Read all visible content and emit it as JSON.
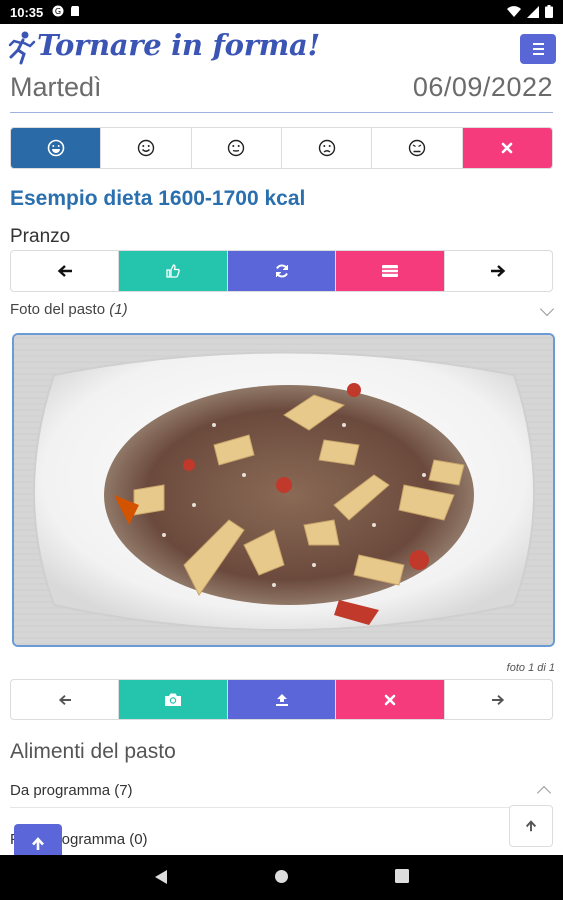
{
  "status": {
    "time": "10:35"
  },
  "app": {
    "title": "Tornare in forma!"
  },
  "header": {
    "day": "Martedì",
    "date": "06/09/2022"
  },
  "diet": {
    "title": "Esempio dieta 1600-1700 kcal",
    "meal": "Pranzo"
  },
  "photo": {
    "label": "Foto del pasto",
    "count": "(1)",
    "caption": "foto 1 di 1"
  },
  "foods": {
    "title": "Alimenti del pasto",
    "sections": [
      {
        "label": "Da programma (7)"
      },
      {
        "label": "Fuori programma (0)"
      }
    ]
  },
  "colors": {
    "blue": "#2a6aa6",
    "teal": "#25c4ad",
    "indigo": "#5b67d8",
    "pink": "#f53b7b",
    "title": "#3b55b5"
  }
}
